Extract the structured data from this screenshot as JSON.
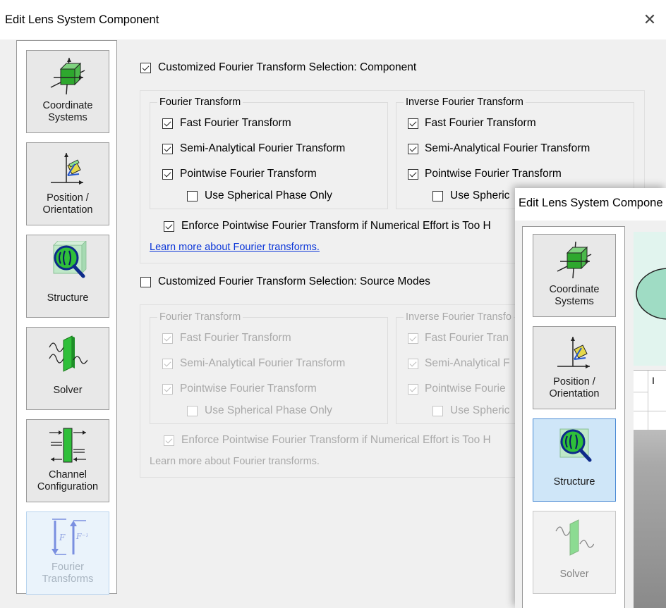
{
  "window": {
    "title": "Edit Lens System Component",
    "close_glyph": "✕"
  },
  "sidebar": {
    "items": [
      {
        "label_line1": "Coordinate",
        "label_line2": "Systems",
        "icon": "coordinate-systems-icon"
      },
      {
        "label_line1": "Position /",
        "label_line2": "Orientation",
        "icon": "position-orientation-icon"
      },
      {
        "label_line1": "",
        "label_line2": "Structure",
        "icon": "structure-icon"
      },
      {
        "label_line1": "",
        "label_line2": "Solver",
        "icon": "solver-icon"
      },
      {
        "label_line1": "Channel",
        "label_line2": "Configuration",
        "icon": "channel-configuration-icon"
      },
      {
        "label_line1": "Fourier",
        "label_line2": "Transforms",
        "icon": "fourier-transforms-icon"
      }
    ]
  },
  "component": {
    "checkbox_label": "Customized Fourier Transform Selection: Component",
    "checked": true,
    "ft_group": {
      "title": "Fourier Transform",
      "fast": "Fast Fourier Transform",
      "semi": "Semi-Analytical Fourier Transform",
      "pointwise": "Pointwise Fourier Transform",
      "spherical": "Use Spherical Phase Only"
    },
    "ift_group": {
      "title": "Inverse Fourier Transform",
      "fast": "Fast Fourier Transform",
      "semi": "Semi-Analytical Fourier Transform",
      "pointwise": "Pointwise Fourier Transform",
      "spherical": "Use Spheric"
    },
    "enforce": "Enforce Pointwise Fourier Transform if Numerical Effort is Too H",
    "link": "Learn more about Fourier transforms."
  },
  "source_modes": {
    "checkbox_label": "Customized Fourier Transform Selection: Source Modes",
    "checked": false,
    "ft_group": {
      "title": "Fourier Transform",
      "fast": "Fast Fourier Transform",
      "semi": "Semi-Analytical Fourier Transform",
      "pointwise": "Pointwise Fourier Transform",
      "spherical": "Use Spherical Phase Only"
    },
    "ift_group": {
      "title": "Inverse Fourier Transfo",
      "fast": "Fast Fourier Tran",
      "semi": "Semi-Analytical F",
      "pointwise": "Pointwise Fourie",
      "spherical": "Use Spheric"
    },
    "enforce": "Enforce Pointwise Fourier Transform if Numerical Effort is Too H",
    "link": "Learn more about Fourier transforms."
  },
  "second_window": {
    "title": "Edit Lens System Compone",
    "sidebar": {
      "items": [
        {
          "label_line1": "Coordinate",
          "label_line2": "Systems"
        },
        {
          "label_line1": "Position /",
          "label_line2": "Orientation"
        },
        {
          "label_line1": "",
          "label_line2": "Structure"
        },
        {
          "label_line1": "",
          "label_line2": "Solver"
        }
      ]
    },
    "table_header_fragment": "I"
  },
  "colors": {
    "accent_selected": "#cfe6f8",
    "link": "#0a35d8",
    "icon_green": "#2aa82a"
  }
}
